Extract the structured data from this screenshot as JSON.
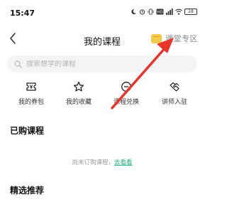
{
  "status_bar": {
    "time": "15:47",
    "battery_level": "28",
    "icons": [
      "moon-icon",
      "alarm-icon",
      "vibrate-icon",
      "hd-icon",
      "signal-icon",
      "wifi-icon",
      "battery-icon"
    ]
  },
  "header": {
    "title": "我的课程",
    "zone_label": "课堂专区",
    "zone_icon": "classroom-icon",
    "zone_icon_color": "#f6c94a"
  },
  "search": {
    "placeholder": "搜索想学的课程"
  },
  "quick_links": [
    {
      "label": "我的券包",
      "icon": "coupon-icon"
    },
    {
      "label": "我的收藏",
      "icon": "star-icon"
    },
    {
      "label": "课程兑换",
      "icon": "exchange-icon"
    },
    {
      "label": "讲师入驻",
      "icon": "handshake-icon"
    }
  ],
  "purchased": {
    "title": "已购课程",
    "empty_text": "尚未订购课程，",
    "empty_link": "去看看",
    "link_color": "#21b07a"
  },
  "recommended": {
    "title": "精选推荐"
  },
  "annotation": {
    "arrow_color": "#e8342a"
  }
}
